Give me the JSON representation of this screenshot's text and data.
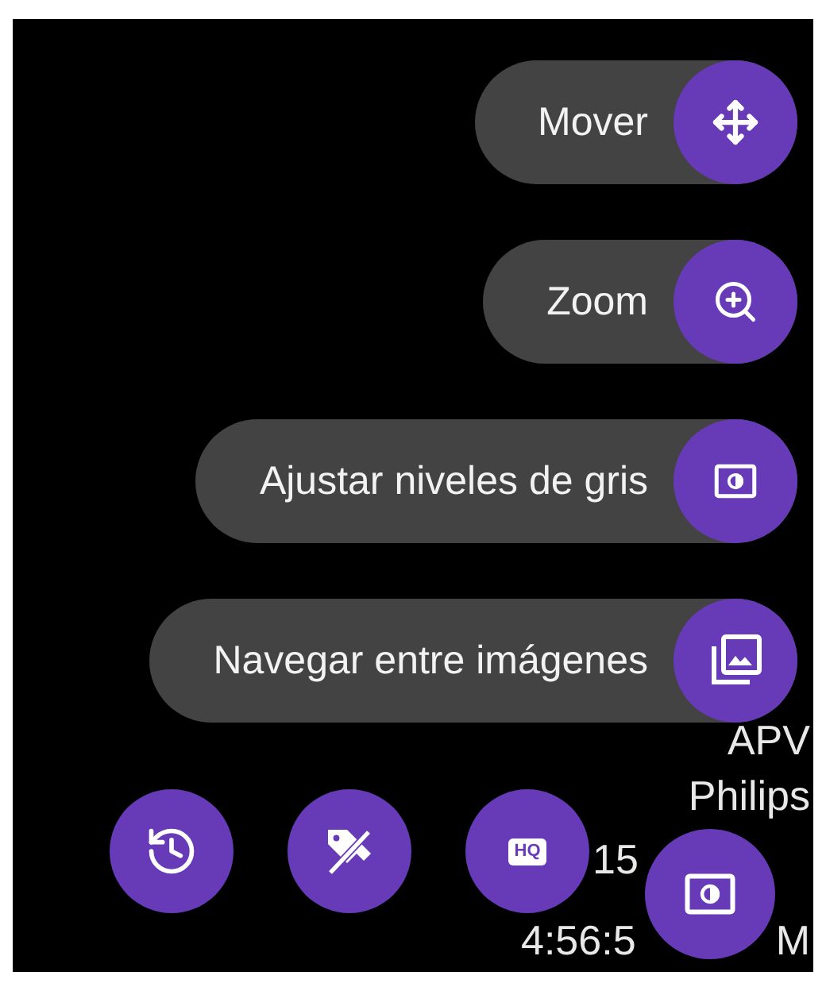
{
  "menu": [
    {
      "label": "Mover",
      "kind": "move"
    },
    {
      "label": "Zoom",
      "kind": "zoom"
    },
    {
      "label": "Ajustar niveles de gris",
      "kind": "levels"
    },
    {
      "label": "Navegar entre imágenes",
      "kind": "images"
    }
  ],
  "toolbar": [
    {
      "kind": "history"
    },
    {
      "kind": "tag-off"
    },
    {
      "kind": "hq",
      "label": "HQ"
    }
  ],
  "fab": {
    "kind": "levels"
  },
  "overlay_text": [
    "APV",
    "Philips",
    "15",
    "4:56:5",
    "M"
  ]
}
